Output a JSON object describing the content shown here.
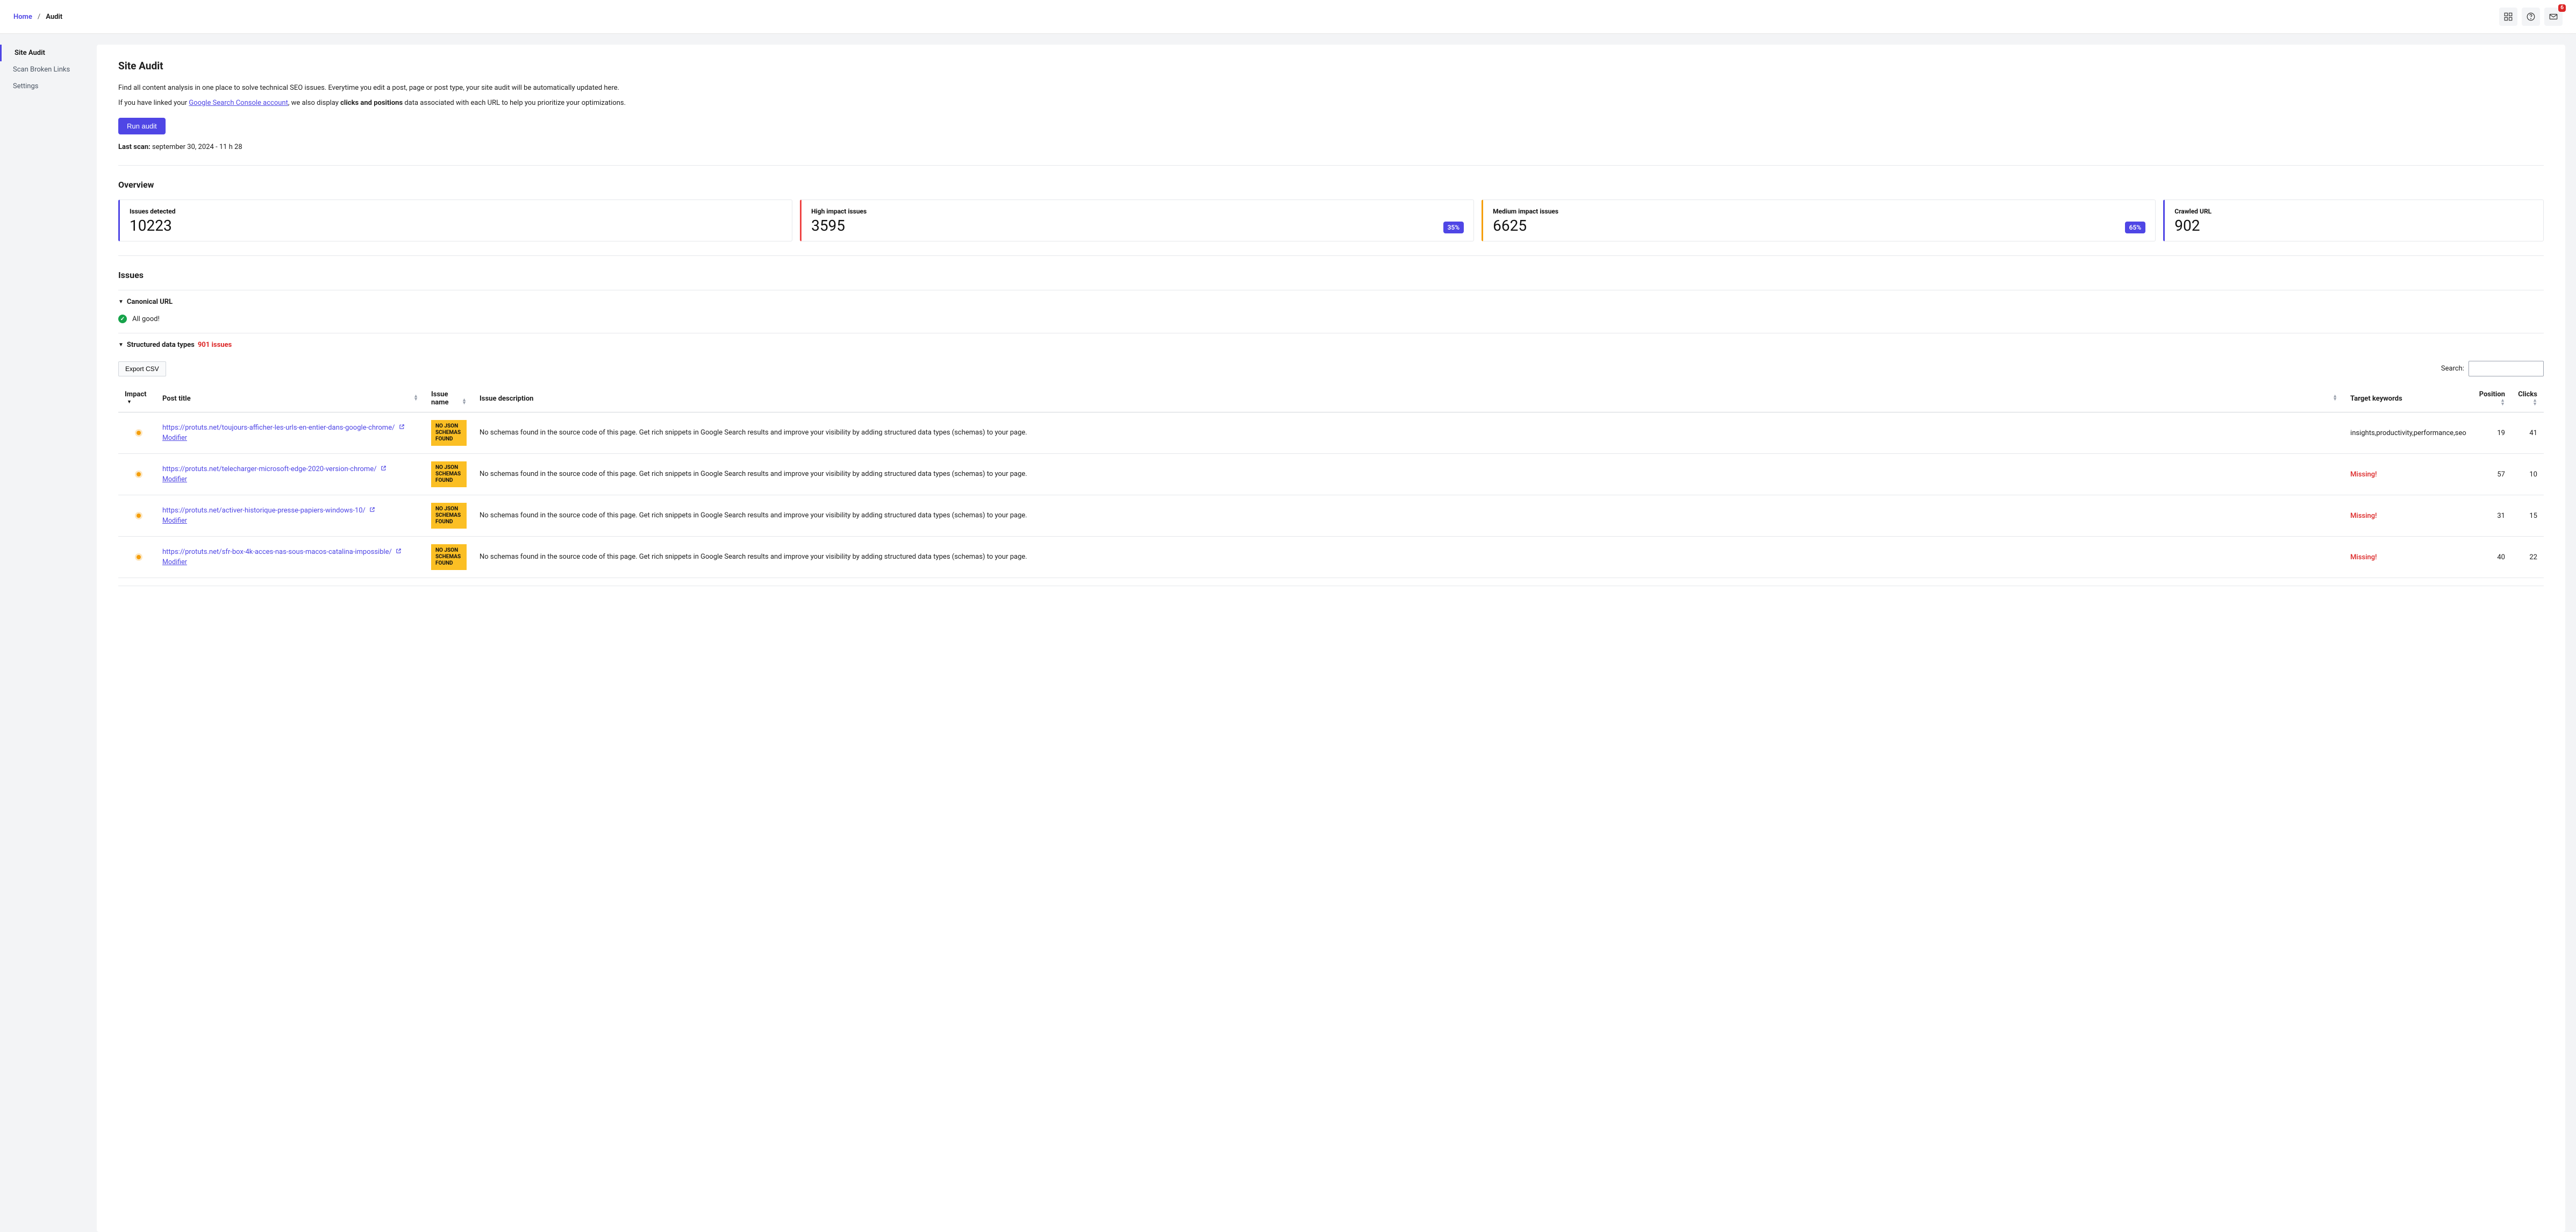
{
  "breadcrumb": {
    "home": "Home",
    "current": "Audit"
  },
  "notifications_count": "6",
  "sidebar": {
    "items": [
      {
        "label": "Site Audit",
        "active": true
      },
      {
        "label": "Scan Broken Links",
        "active": false
      },
      {
        "label": "Settings",
        "active": false
      }
    ]
  },
  "page": {
    "title": "Site Audit",
    "intro_line1": "Find all content analysis in one place to solve technical SEO issues. Everytime you edit a post, page or post type, your site audit will be automatically updated here.",
    "intro_prefix": "If you have linked your ",
    "intro_link": "Google Search Console account",
    "intro_mid": ", we also display ",
    "intro_bold": "clicks and positions",
    "intro_suffix": " data associated with each URL to help you prioritize your optimizations.",
    "run_button": "Run audit",
    "last_scan_label": "Last scan:",
    "last_scan_value": "september 30, 2024 - 11 h 28"
  },
  "overview": {
    "title": "Overview",
    "cards": [
      {
        "label": "Issues detected",
        "value": "10223"
      },
      {
        "label": "High impact issues",
        "value": "3595",
        "pct": "35%"
      },
      {
        "label": "Medium impact issues",
        "value": "6625",
        "pct": "65%"
      },
      {
        "label": "Crawled URL",
        "value": "902"
      }
    ]
  },
  "issues": {
    "title": "Issues",
    "canonical": {
      "label": "Canonical URL",
      "all_good": "All good!"
    },
    "structured": {
      "label": "Structured data types",
      "count": "901 issues"
    }
  },
  "table": {
    "export": "Export CSV",
    "search_label": "Search:",
    "headers": {
      "impact": "Impact",
      "post_title": "Post title",
      "issue_name": "Issue name",
      "issue_desc": "Issue description",
      "target_kw": "Target keywords",
      "position": "Position",
      "clicks": "Clicks"
    },
    "issue_badge": "NO JSON SCHEMAS FOUND",
    "desc_text": "No schemas found in the source code of this page. Get rich snippets in Google Search results and improve your visibility by adding structured data types (schemas) to your page.",
    "modifier": "Modifier",
    "missing": "Missing!",
    "rows": [
      {
        "url": "https://protuts.net/toujours-afficher-les-urls-en-entier-dans-google-chrome/",
        "tk": "insights,productivity,performance,seo",
        "position": "19",
        "clicks": "41"
      },
      {
        "url": "https://protuts.net/telecharger-microsoft-edge-2020-version-chrome/",
        "tk": "__missing__",
        "position": "57",
        "clicks": "10"
      },
      {
        "url": "https://protuts.net/activer-historique-presse-papiers-windows-10/",
        "tk": "__missing__",
        "position": "31",
        "clicks": "15"
      },
      {
        "url": "https://protuts.net/sfr-box-4k-acces-nas-sous-macos-catalina-impossible/",
        "tk": "__missing__",
        "position": "40",
        "clicks": "22"
      }
    ]
  }
}
